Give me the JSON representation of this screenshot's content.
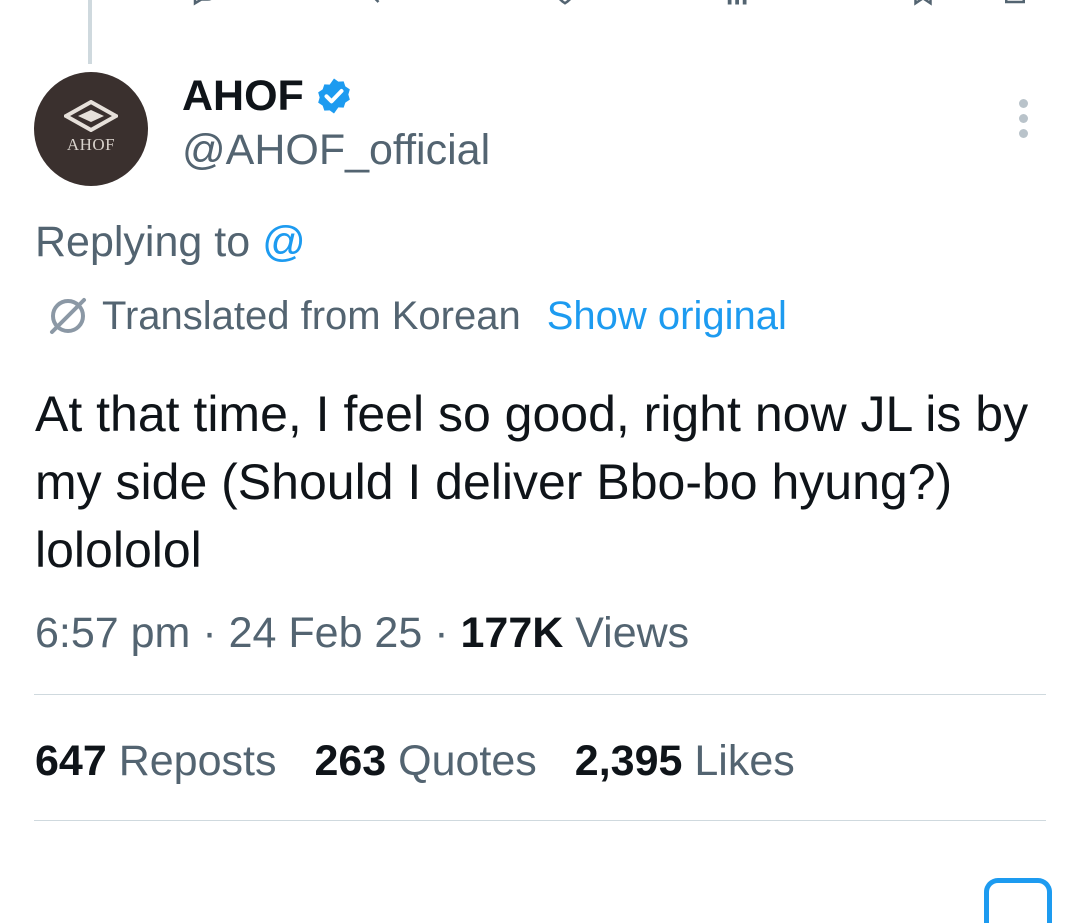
{
  "tweet": {
    "display_name": "AHOF",
    "handle": "@AHOF_official",
    "avatar_text": "AHOF",
    "replying_prefix": "Replying to ",
    "replying_handle": "@",
    "translated_label": "Translated from Korean",
    "show_original_label": "Show original",
    "text": "At that time, I feel so good, right now JL is by my side (Should I deliver Bbo-bo hyung?) lolololol",
    "time": "6:57 pm",
    "date": "24 Feb 25",
    "views_count": "177K",
    "views_label": "Views"
  },
  "stats": {
    "reposts_count": "647",
    "reposts_label": "Reposts",
    "quotes_count": "263",
    "quotes_label": "Quotes",
    "likes_count": "2,395",
    "likes_label": "Likes"
  },
  "colors": {
    "accent": "#1d9bf0",
    "secondary_text": "#536471",
    "primary_text": "#0f1419",
    "divider": "#cfd9de"
  },
  "icons": [
    "reply-icon",
    "repost-icon",
    "like-icon",
    "views-icon",
    "bookmark-icon",
    "share-icon",
    "verified-icon",
    "more-icon",
    "translate-icon"
  ]
}
